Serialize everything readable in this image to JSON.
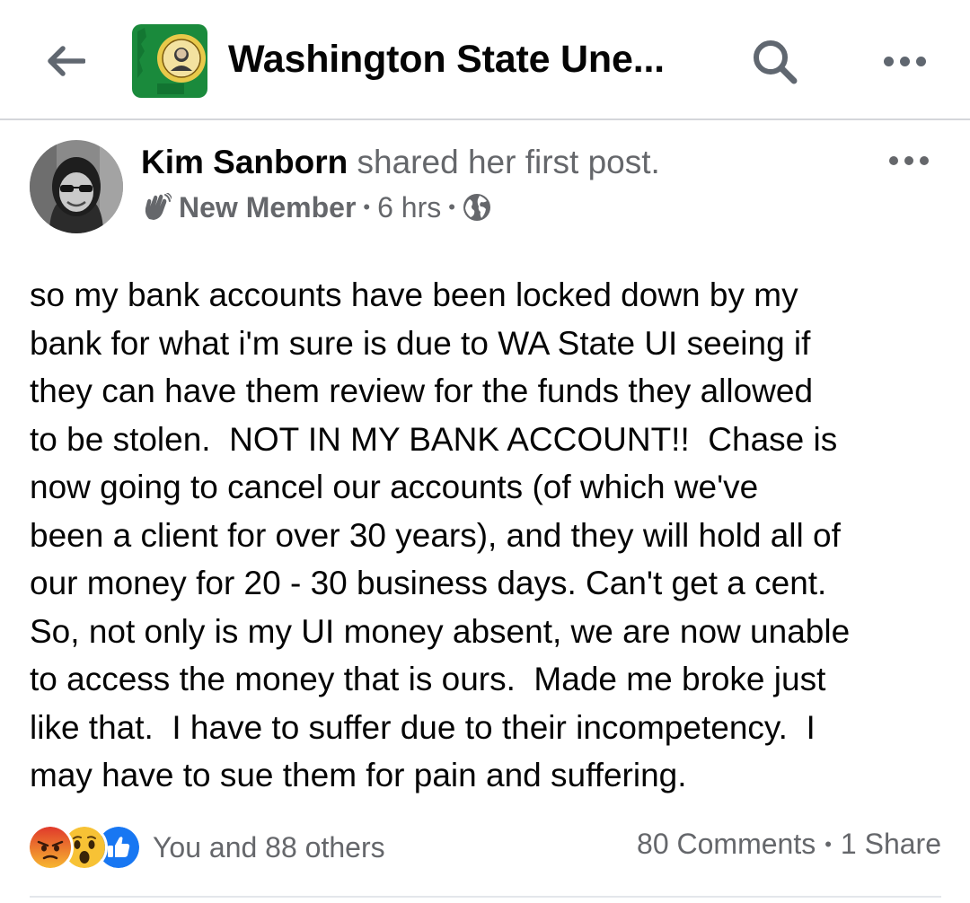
{
  "header": {
    "title": "Washington State Une...",
    "back_icon": "arrow-left-icon",
    "search_icon": "search-icon",
    "more_icon": "more-horizontal-icon",
    "logo_colors": {
      "field": "#1a8a3c",
      "seal": "#e8c94a"
    }
  },
  "post": {
    "author": "Kim Sanborn",
    "action": "shared her first post.",
    "badge_icon": "wave-hand-icon",
    "badge": "New Member",
    "time": "6 hrs",
    "privacy_icon": "globe-icon",
    "body": "so my bank accounts have been locked down by my\nbank for what i'm sure is due to WA State UI seeing if\nthey can have them review for the funds they allowed\nto be stolen.  NOT IN MY BANK ACCOUNT!!  Chase is\nnow going to cancel our accounts (of which we've\nbeen a client for over 30 years), and they will hold all of\nour money for 20 - 30 business days. Can't get a cent.\nSo, not only is my UI money absent, we are now unable\nto access the money that is ours.  Made me broke just\nlike that.  I have to suffer due to their incompetency.  I\nmay have to sue them for pain and suffering."
  },
  "footer": {
    "reaction_icons": [
      "angry-reaction-icon",
      "wow-reaction-icon",
      "like-reaction-icon"
    ],
    "reactions_text": "You and 88 others",
    "comments": "80 Comments",
    "shares": "1 Share"
  },
  "colors": {
    "secondary_text": "#65676b",
    "like_blue": "#1877f2",
    "angry": "#f15a24",
    "wow": "#f7c235"
  }
}
